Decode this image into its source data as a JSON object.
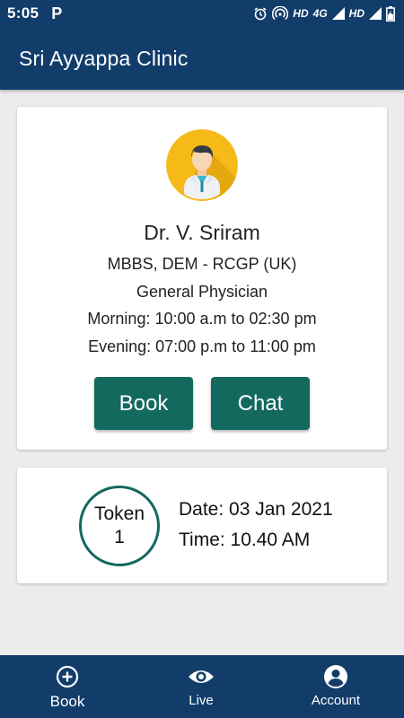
{
  "status_bar": {
    "time": "5:05",
    "app_icon": "P",
    "network_1": "HD",
    "network_type": "4G",
    "network_2": "HD"
  },
  "app_bar": {
    "title": "Sri Ayyappa Clinic"
  },
  "doctor": {
    "name": "Dr. V. Sriram",
    "qualification": "MBBS, DEM - RCGP (UK)",
    "specialty": "General Physician",
    "morning": "Morning: 10:00 a.m to 02:30 pm",
    "evening": "Evening: 07:00 p.m to 11:00 pm",
    "book_label": "Book",
    "chat_label": "Chat"
  },
  "token": {
    "label": "Token",
    "number": "1",
    "date": "Date: 03 Jan 2021",
    "time": "Time: 10.40 AM"
  },
  "bottom_nav": {
    "items": [
      {
        "label": "Book",
        "icon": "add-circle-icon"
      },
      {
        "label": "Live",
        "icon": "eye-icon"
      },
      {
        "label": "Account",
        "icon": "account-circle-icon"
      }
    ]
  },
  "colors": {
    "primary": "#123d6b",
    "accent": "#14695f",
    "background": "#ececec",
    "card": "#ffffff"
  }
}
